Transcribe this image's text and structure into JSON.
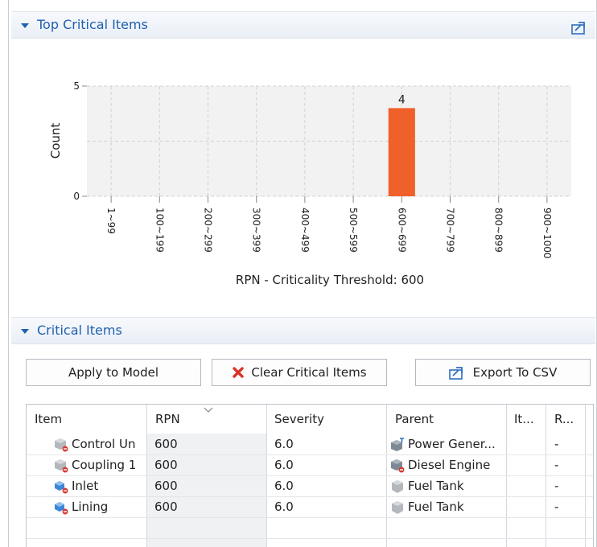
{
  "top_section": {
    "title": "Top Critical Items",
    "export_icon": "export-chart-icon"
  },
  "chart_data": {
    "type": "bar",
    "categories": [
      "1~99",
      "100~199",
      "200~299",
      "300~399",
      "400~499",
      "500~599",
      "600~699",
      "700~799",
      "800~899",
      "900~1000"
    ],
    "values": [
      0,
      0,
      0,
      0,
      0,
      0,
      4,
      0,
      0,
      0
    ],
    "data_labels": [
      "",
      "",
      "",
      "",
      "",
      "",
      "4",
      "",
      "",
      ""
    ],
    "xlabel": "RPN - Criticality Threshold: 600",
    "ylabel": "Count",
    "ylim": [
      0,
      5
    ],
    "yticks": [
      "0",
      "5"
    ],
    "grid": true,
    "bar_color": "#f0602a"
  },
  "critical_section": {
    "title": "Critical Items"
  },
  "buttons": {
    "apply": "Apply to Model",
    "clear": "Clear Critical Items",
    "export": "Export To CSV"
  },
  "table": {
    "headers": [
      "Item",
      "RPN",
      "Severity",
      "Parent",
      "It...",
      "R..."
    ],
    "rows": [
      {
        "item": "Control Un",
        "rpn": "600",
        "severity": "6.0",
        "parent": "Power Gener...",
        "it": "",
        "r": "-"
      },
      {
        "item": "Coupling 1",
        "rpn": "600",
        "severity": "6.0",
        "parent": "Diesel Engine",
        "it": "",
        "r": "-"
      },
      {
        "item": "Inlet",
        "rpn": "600",
        "severity": "6.0",
        "parent": "Fuel Tank",
        "it": "",
        "r": "-"
      },
      {
        "item": "Lining",
        "rpn": "600",
        "severity": "6.0",
        "parent": "Fuel Tank",
        "it": "",
        "r": "-"
      }
    ]
  }
}
